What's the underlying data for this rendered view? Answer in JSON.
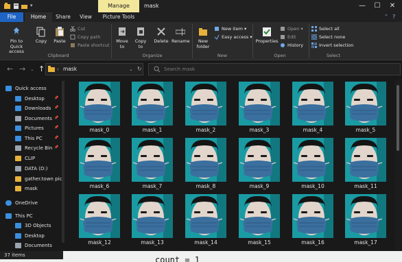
{
  "window": {
    "title": "mask",
    "context_tab": "Manage",
    "controls": [
      "—",
      "☐",
      "✕"
    ]
  },
  "ribbon_tabs": [
    "File",
    "Home",
    "Share",
    "View",
    "Picture Tools"
  ],
  "ribbon": {
    "clipboard": {
      "label": "Clipboard",
      "pin": "Pin to Quick\naccess",
      "copy": "Copy",
      "paste": "Paste",
      "cut": "Cut",
      "copy_path": "Copy path",
      "paste_shortcut": "Paste shortcut"
    },
    "organize": {
      "label": "Organize",
      "move_to": "Move\nto",
      "copy_to": "Copy\nto",
      "delete": "Delete",
      "rename": "Rename"
    },
    "new": {
      "label": "New",
      "new_folder": "New\nfolder",
      "new_item": "New item",
      "easy_access": "Easy access"
    },
    "open": {
      "label": "Open",
      "properties": "Properties",
      "open": "Open",
      "edit": "Edit",
      "history": "History"
    },
    "select": {
      "label": "Select",
      "select_all": "Select all",
      "select_none": "Select none",
      "invert": "Invert selection"
    }
  },
  "address": {
    "path": "mask",
    "search_placeholder": "Search mask"
  },
  "nav_pane": [
    {
      "label": "Quick access",
      "icon": "star-icon",
      "color": "#3b8fe0",
      "pinned": false
    },
    {
      "label": "Desktop",
      "icon": "desktop-icon",
      "color": "#3b8fe0",
      "pinned": true
    },
    {
      "label": "Downloads",
      "icon": "download-icon",
      "color": "#3b8fe0",
      "pinned": true
    },
    {
      "label": "Documents",
      "icon": "documents-icon",
      "color": "#9aa4b0",
      "pinned": true
    },
    {
      "label": "Pictures",
      "icon": "pictures-icon",
      "color": "#3b8fe0",
      "pinned": true
    },
    {
      "label": "This PC",
      "icon": "pc-icon",
      "color": "#3b8fe0",
      "pinned": true
    },
    {
      "label": "Recycle Bin",
      "icon": "recycle-bin-icon",
      "color": "#9aa4b0",
      "pinned": true
    },
    {
      "label": "CLIP",
      "icon": "folder-icon",
      "color": "#e8b23a",
      "pinned": false
    },
    {
      "label": "DATA (D:)",
      "icon": "drive-icon",
      "color": "#9aa4b0",
      "pinned": false
    },
    {
      "label": "gather.town pic",
      "icon": "folder-icon",
      "color": "#e8b23a",
      "pinned": false
    },
    {
      "label": "mask",
      "icon": "folder-icon",
      "color": "#e8b23a",
      "pinned": false
    },
    {
      "label": "OneDrive",
      "icon": "cloud-icon",
      "color": "#3b8fe0",
      "pinned": false
    },
    {
      "label": "This PC",
      "icon": "pc-icon",
      "color": "#3b8fe0",
      "pinned": false
    },
    {
      "label": "3D Objects",
      "icon": "cube-icon",
      "color": "#3b8fe0",
      "pinned": false
    },
    {
      "label": "Desktop",
      "icon": "desktop-icon",
      "color": "#3b8fe0",
      "pinned": false
    },
    {
      "label": "Documents",
      "icon": "documents-icon",
      "color": "#9aa4b0",
      "pinned": false
    }
  ],
  "files": [
    "mask_0",
    "mask_1",
    "mask_2",
    "mask_3",
    "mask_4",
    "mask_5",
    "mask_6",
    "mask_7",
    "mask_8",
    "mask_9",
    "mask_10",
    "mask_11",
    "mask_12",
    "mask_13",
    "mask_14",
    "mask_15",
    "mask_16",
    "mask_17"
  ],
  "status": {
    "count": "37 items",
    "overlay": "count = 1"
  },
  "colors": {
    "teal_background": "#1a9ba3",
    "mask_blue": "#3a6f9e",
    "accent_blue": "#1f64c4"
  }
}
